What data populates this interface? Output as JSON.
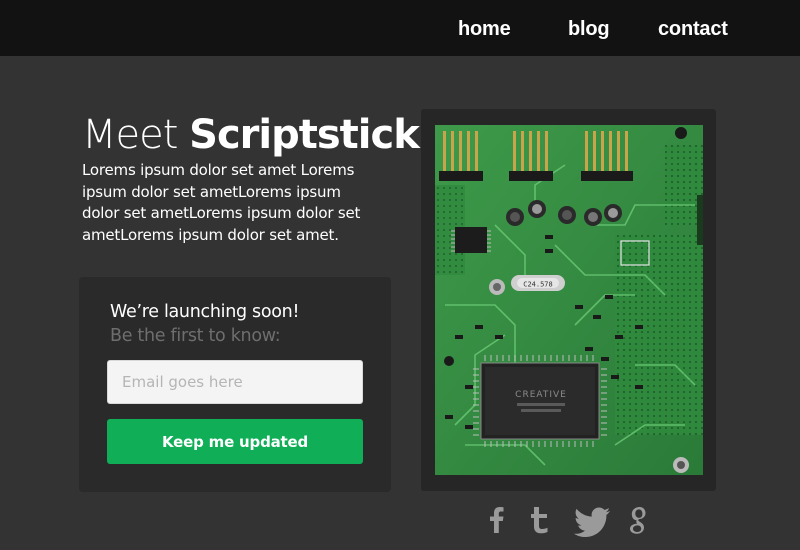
{
  "nav": {
    "items": [
      {
        "label": "home"
      },
      {
        "label": "blog"
      },
      {
        "label": "contact"
      }
    ]
  },
  "hero": {
    "title_prefix": "Meet",
    "title_brand": "Scriptstick",
    "body": "Lorems ipsum dolor set amet Lorems ipsum dolor set ametLorems ipsum dolor set ametLorems ipsum dolor set ametLorems ipsum dolor set amet."
  },
  "signup": {
    "heading": "We’re launching soon!",
    "subheading": "Be the first to know:",
    "email_placeholder": "Email goes here",
    "email_value": "",
    "button_label": "Keep me updated"
  },
  "image": {
    "chip_label": "CREATIVE",
    "crystal_label": "C24.578"
  },
  "social": {
    "icons": [
      "facebook-icon",
      "tumblr-icon",
      "twitter-icon",
      "google-plus-icon"
    ]
  },
  "colors": {
    "page_bg": "#333333",
    "nav_bg": "#121212",
    "panel_bg": "#2a2a2a",
    "accent_green": "#0fae57",
    "muted_text": "#6e6e6e"
  }
}
